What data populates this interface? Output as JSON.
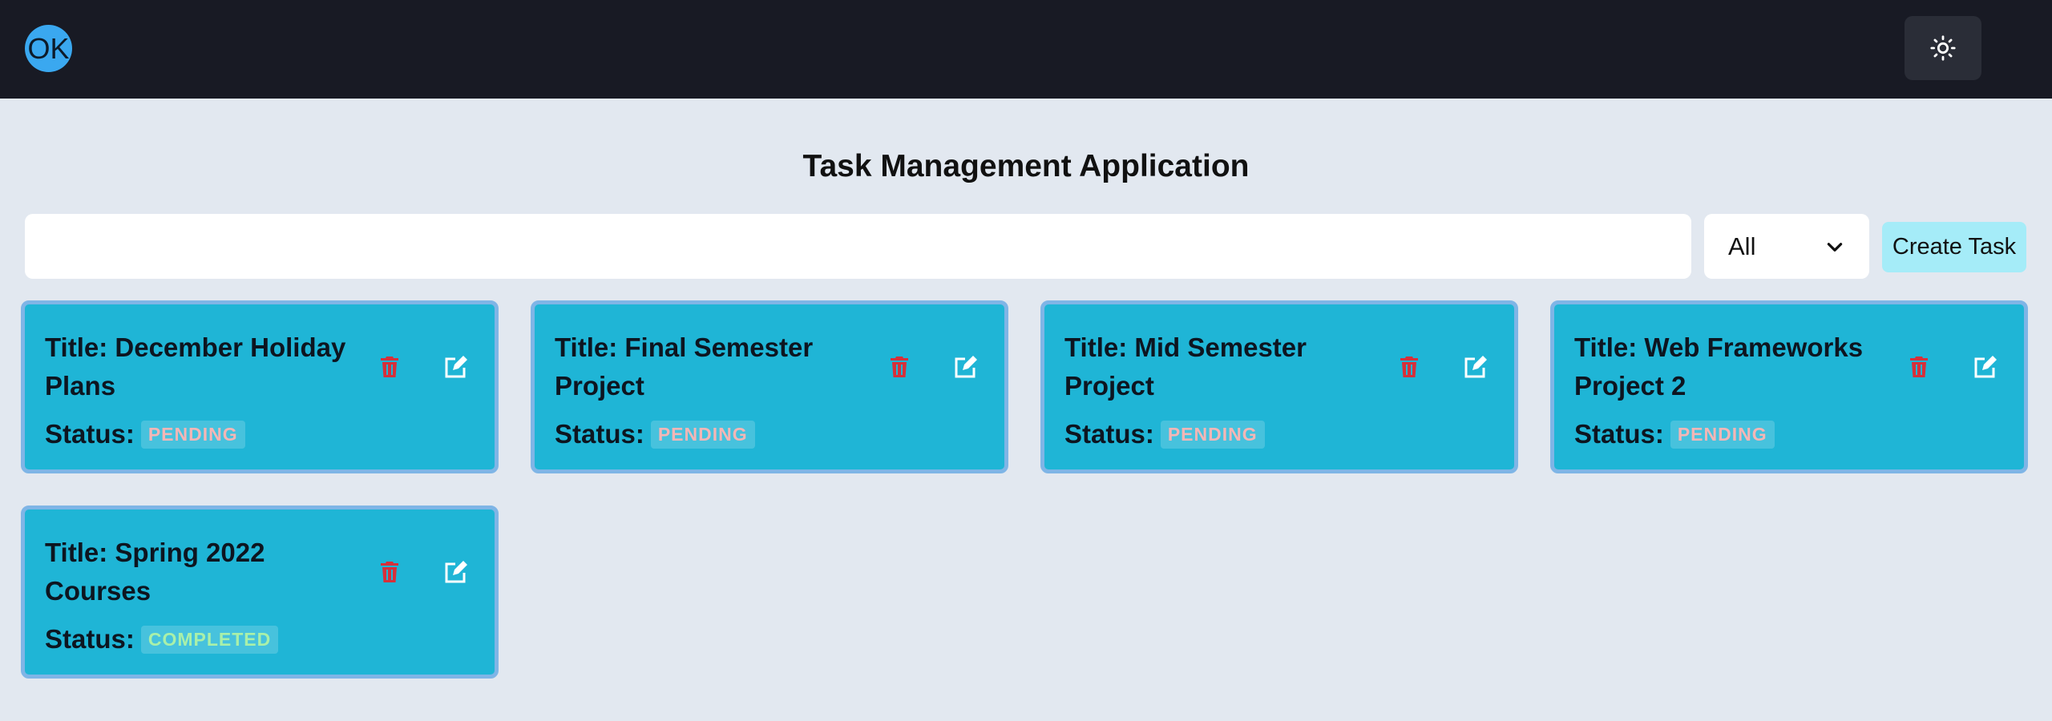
{
  "navbar": {
    "avatar_text": "OK",
    "theme_toggle_icon": "sun-icon"
  },
  "page_title": "Task Management Application",
  "search": {
    "value": "",
    "placeholder": ""
  },
  "filter": {
    "selected": "All",
    "icon": "chevron-down-icon"
  },
  "create_button_label": "Create Task",
  "colors": {
    "navbar_bg": "#181a24",
    "page_bg": "#e2e8f0",
    "card_bg": "#1fb5d6",
    "card_border": "#7fb5e6",
    "delete_icon": "#d6303a",
    "edit_icon": "#ffffff",
    "create_button_bg": "#a5ecf8",
    "pending_text": "#f5b6b6",
    "completed_text": "#a9f0a9"
  },
  "tasks": [
    {
      "title": "Title: December Holiday Plans",
      "status_label": "Status:",
      "status": "PENDING"
    },
    {
      "title": "Title: Final Semester Project",
      "status_label": "Status:",
      "status": "PENDING"
    },
    {
      "title": "Title: Mid Semester Project",
      "status_label": "Status:",
      "status": "PENDING"
    },
    {
      "title": "Title: Web Frameworks Project 2",
      "status_label": "Status:",
      "status": "PENDING"
    },
    {
      "title": "Title: Spring 2022 Courses",
      "status_label": "Status:",
      "status": "COMPLETED"
    }
  ]
}
